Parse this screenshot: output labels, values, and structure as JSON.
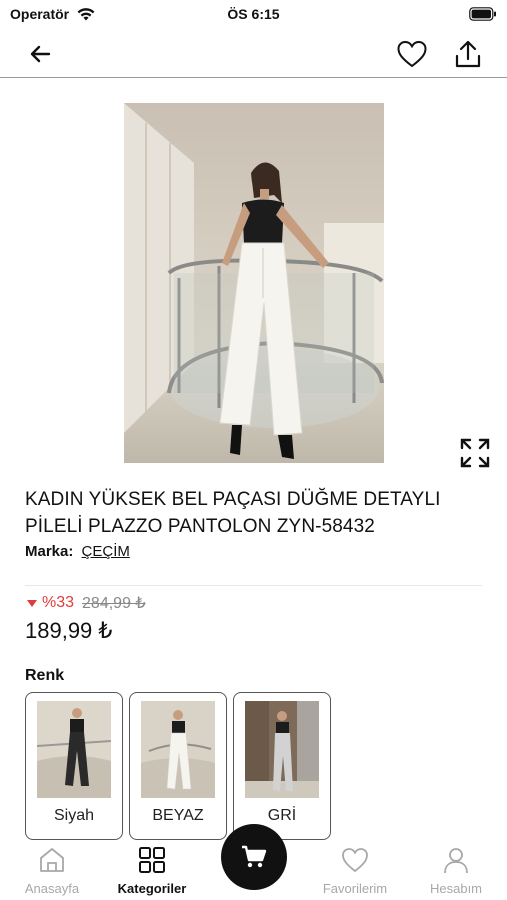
{
  "status": {
    "carrier": "Operatör",
    "time": "ÖS 6:15"
  },
  "product": {
    "title_line1": "KADIN YÜKSEK BEL PAÇASI DÜĞME DETAYLI",
    "title_line2": "PİLELİ PLAZZO PANTOLON ZYN-58432",
    "brand_label": "Marka:",
    "brand_value": "ÇEÇİM",
    "discount": "%33",
    "old_price": "284,99 ₺",
    "price": "189,99 ₺"
  },
  "colors": {
    "heading": "Renk",
    "options": [
      {
        "label": "Siyah",
        "pants_color": "#2a2a2a"
      },
      {
        "label": "BEYAZ",
        "pants_color": "#f4f1ea"
      },
      {
        "label": "GRİ",
        "pants_color": "#cfcfcf"
      }
    ]
  },
  "tabs": [
    {
      "label": "Anasayfa",
      "icon": "home-icon"
    },
    {
      "label": "Kategoriler",
      "icon": "grid-icon"
    },
    {
      "label": "Favorilerim",
      "icon": "heart-icon"
    },
    {
      "label": "Hesabım",
      "icon": "user-icon"
    }
  ],
  "accent": {
    "discount": "#e03b3b",
    "fab": "#111111"
  }
}
